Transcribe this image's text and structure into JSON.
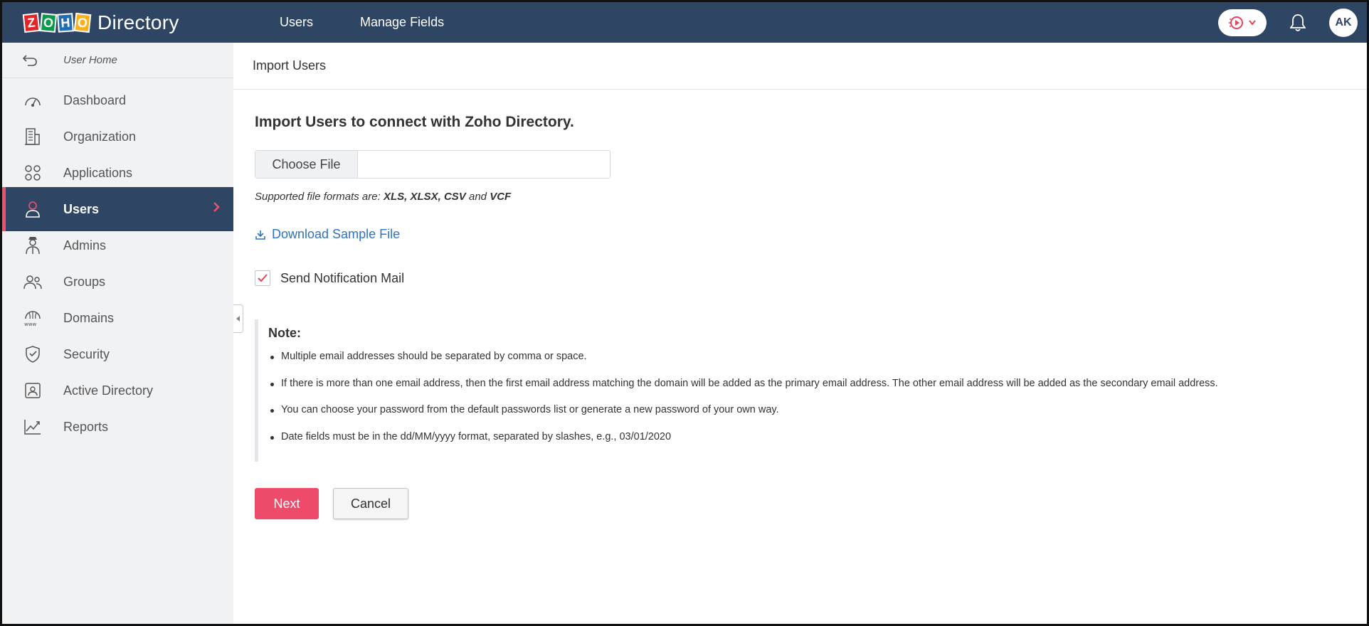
{
  "brand": {
    "logo_letters": [
      "Z",
      "O",
      "H",
      "O"
    ],
    "logo_colors": [
      "#e42527",
      "#089949",
      "#226db4",
      "#f9b21d"
    ],
    "product": "Directory"
  },
  "topnav": {
    "items": [
      "Users",
      "Manage Fields"
    ]
  },
  "header": {
    "avatar_initials": "AK",
    "accent": "#2e4563"
  },
  "sidebar": {
    "home_label": "User Home",
    "items": [
      {
        "label": "Dashboard",
        "icon": "gauge-icon"
      },
      {
        "label": "Organization",
        "icon": "building-icon"
      },
      {
        "label": "Applications",
        "icon": "grid-icon"
      },
      {
        "label": "Users",
        "icon": "user-icon",
        "active": true
      },
      {
        "label": "Admins",
        "icon": "admin-icon"
      },
      {
        "label": "Groups",
        "icon": "group-icon"
      },
      {
        "label": "Domains",
        "icon": "www-icon"
      },
      {
        "label": "Security",
        "icon": "shield-icon"
      },
      {
        "label": "Active Directory",
        "icon": "id-card-icon"
      },
      {
        "label": "Reports",
        "icon": "chart-icon"
      }
    ]
  },
  "page": {
    "breadcrumb_title": "Import Users",
    "heading": "Import Users to connect with Zoho Directory.",
    "choose_file_label": "Choose File",
    "formats_prefix": "Supported file formats are:",
    "formats_list": "XLS, XLSX, CSV",
    "formats_and": "and",
    "formats_last": "VCF",
    "download_label": "Download Sample File",
    "notification_label": "Send Notification Mail",
    "notification_checked": true,
    "note_title": "Note:",
    "notes": [
      "Multiple email addresses should be separated by comma or space.",
      "If there is more than one email address, then the first email address matching the domain will be added as the primary email address. The other email address will be added as the secondary email address.",
      "You can choose your password from the default passwords list or generate a new password of your own way.",
      "Date fields must be in the dd/MM/yyyy format, separated by slashes, e.g., 03/01/2020"
    ],
    "next_label": "Next",
    "cancel_label": "Cancel",
    "primary_color": "#ee4b6b",
    "link_color": "#2f72c4"
  }
}
